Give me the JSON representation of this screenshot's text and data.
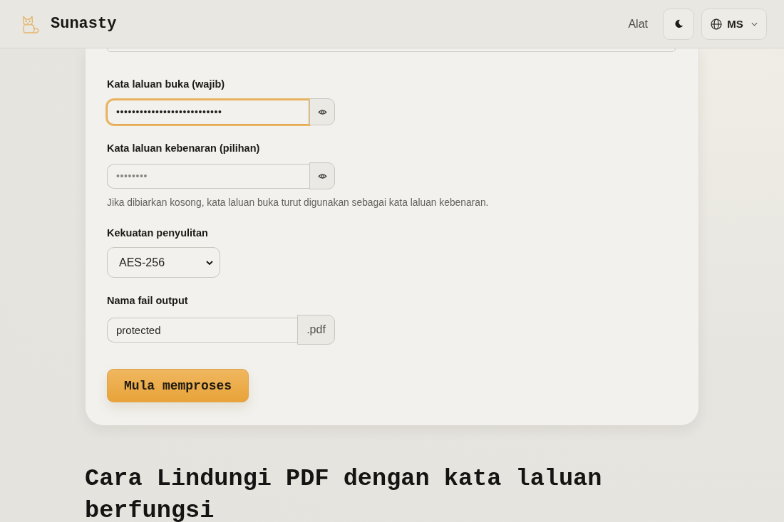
{
  "header": {
    "brand": "Sunasty",
    "nav_link": "Alat",
    "language": "MS"
  },
  "form": {
    "fields": [
      {
        "kind": "password",
        "label": "Kata laluan buka (wajib)",
        "value": "•••••••••••••••••••••••••••",
        "focused": true
      },
      {
        "kind": "password",
        "label": "Kata laluan kebenaran (pilihan)",
        "placeholder": "••••••••",
        "focused": false,
        "hint": "Jika dibiarkan kosong, kata laluan buka turut digunakan sebagai kata laluan kebenaran."
      },
      {
        "kind": "select",
        "label": "Kekuatan penyulitan",
        "value": "AES-256"
      },
      {
        "kind": "text_suffix",
        "label": "Nama fail output",
        "value": "protected",
        "suffix": ".pdf"
      }
    ],
    "submit": "Mula memproses"
  },
  "heading": "Cara Lindungi PDF dengan kata laluan berfungsi"
}
